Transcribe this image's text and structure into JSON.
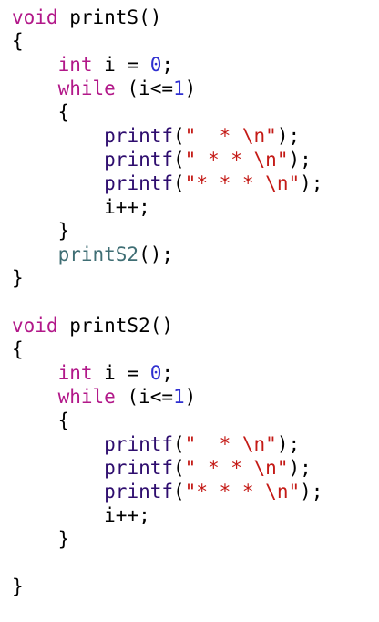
{
  "code_lines": [
    [
      {
        "t": "void",
        "c": "kw"
      },
      {
        "t": " printS()",
        "c": "plain"
      }
    ],
    [
      {
        "t": "{",
        "c": "plain"
      }
    ],
    [
      {
        "t": "    ",
        "c": "plain"
      },
      {
        "t": "int",
        "c": "type"
      },
      {
        "t": " i = ",
        "c": "plain"
      },
      {
        "t": "0",
        "c": "num"
      },
      {
        "t": ";",
        "c": "plain"
      }
    ],
    [
      {
        "t": "    ",
        "c": "plain"
      },
      {
        "t": "while",
        "c": "kw"
      },
      {
        "t": " (i<=",
        "c": "plain"
      },
      {
        "t": "1",
        "c": "num"
      },
      {
        "t": ")",
        "c": "plain"
      }
    ],
    [
      {
        "t": "    {",
        "c": "plain"
      }
    ],
    [
      {
        "t": "        ",
        "c": "plain"
      },
      {
        "t": "printf",
        "c": "fn"
      },
      {
        "t": "(",
        "c": "plain"
      },
      {
        "t": "\"  * \\n\"",
        "c": "str"
      },
      {
        "t": ");",
        "c": "plain"
      }
    ],
    [
      {
        "t": "        ",
        "c": "plain"
      },
      {
        "t": "printf",
        "c": "fn"
      },
      {
        "t": "(",
        "c": "plain"
      },
      {
        "t": "\" * * \\n\"",
        "c": "str"
      },
      {
        "t": ");",
        "c": "plain"
      }
    ],
    [
      {
        "t": "        ",
        "c": "plain"
      },
      {
        "t": "printf",
        "c": "fn"
      },
      {
        "t": "(",
        "c": "plain"
      },
      {
        "t": "\"* * * \\n\"",
        "c": "str"
      },
      {
        "t": ");",
        "c": "plain"
      }
    ],
    [
      {
        "t": "        i++;",
        "c": "plain"
      }
    ],
    [
      {
        "t": "    }",
        "c": "plain"
      }
    ],
    [
      {
        "t": "    ",
        "c": "plain"
      },
      {
        "t": "printS2",
        "c": "fn-user"
      },
      {
        "t": "();",
        "c": "plain"
      }
    ],
    [
      {
        "t": "}",
        "c": "plain"
      }
    ],
    [],
    [
      {
        "t": "void",
        "c": "kw"
      },
      {
        "t": " printS2()",
        "c": "plain"
      }
    ],
    [
      {
        "t": "{",
        "c": "plain"
      }
    ],
    [
      {
        "t": "    ",
        "c": "plain"
      },
      {
        "t": "int",
        "c": "type"
      },
      {
        "t": " i = ",
        "c": "plain"
      },
      {
        "t": "0",
        "c": "num"
      },
      {
        "t": ";",
        "c": "plain"
      }
    ],
    [
      {
        "t": "    ",
        "c": "plain"
      },
      {
        "t": "while",
        "c": "kw"
      },
      {
        "t": " (i<=",
        "c": "plain"
      },
      {
        "t": "1",
        "c": "num"
      },
      {
        "t": ")",
        "c": "plain"
      }
    ],
    [
      {
        "t": "    {",
        "c": "plain"
      }
    ],
    [
      {
        "t": "        ",
        "c": "plain"
      },
      {
        "t": "printf",
        "c": "fn"
      },
      {
        "t": "(",
        "c": "plain"
      },
      {
        "t": "\"  * \\n\"",
        "c": "str"
      },
      {
        "t": ");",
        "c": "plain"
      }
    ],
    [
      {
        "t": "        ",
        "c": "plain"
      },
      {
        "t": "printf",
        "c": "fn"
      },
      {
        "t": "(",
        "c": "plain"
      },
      {
        "t": "\" * * \\n\"",
        "c": "str"
      },
      {
        "t": ");",
        "c": "plain"
      }
    ],
    [
      {
        "t": "        ",
        "c": "plain"
      },
      {
        "t": "printf",
        "c": "fn"
      },
      {
        "t": "(",
        "c": "plain"
      },
      {
        "t": "\"* * * \\n\"",
        "c": "str"
      },
      {
        "t": ");",
        "c": "plain"
      }
    ],
    [
      {
        "t": "        i++;",
        "c": "plain"
      }
    ],
    [
      {
        "t": "    }",
        "c": "plain"
      }
    ],
    [],
    [
      {
        "t": "}",
        "c": "plain"
      }
    ]
  ],
  "colors": {
    "background": "#ffffff",
    "keyword": "#b21889",
    "number": "#2f2fd0",
    "string": "#c41a16",
    "function": "#2e0d6e",
    "user_function": "#3f6e74",
    "plain": "#000000"
  }
}
